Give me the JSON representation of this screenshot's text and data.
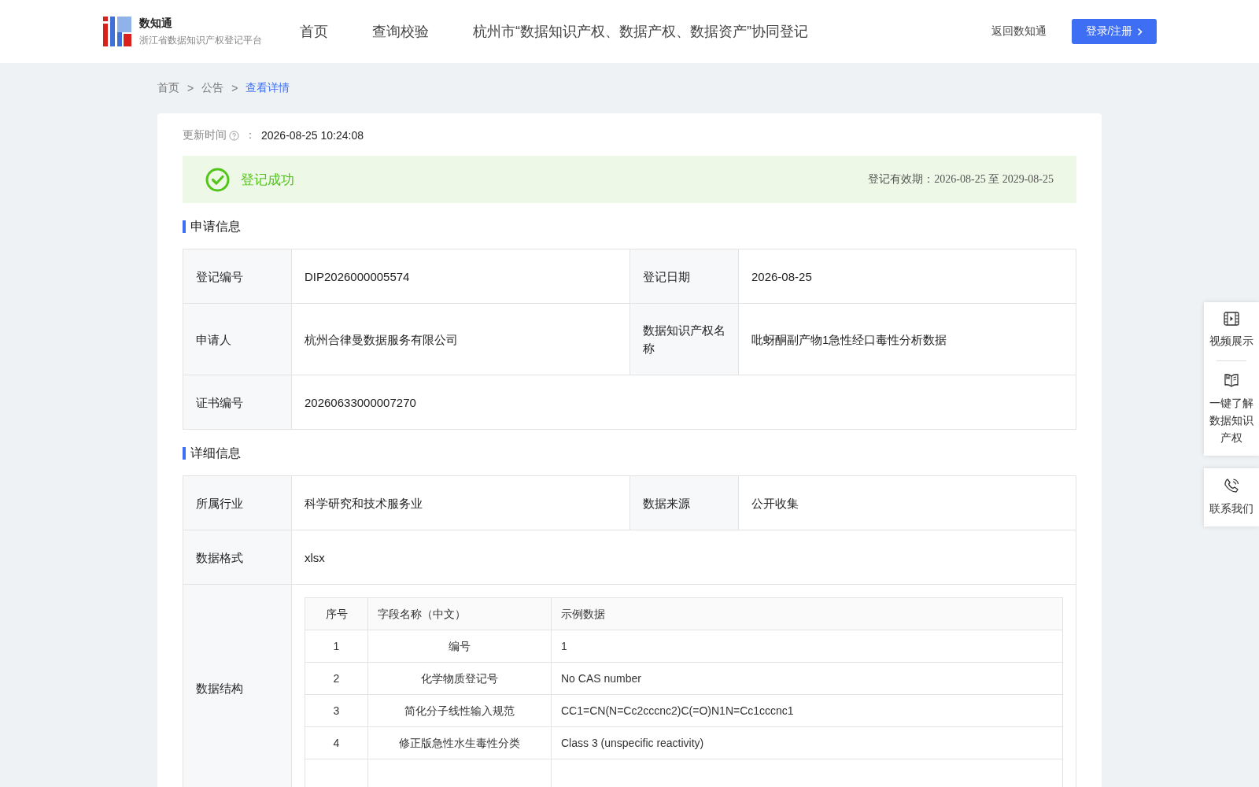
{
  "header": {
    "logo": {
      "title": "数知通",
      "subtitle": "浙江省数据知识产权登记平台"
    },
    "nav": [
      {
        "label": "首页",
        "selected": false
      },
      {
        "label": "查询校验",
        "selected": false
      },
      {
        "label": "杭州市“数据知识产权、数据产权、数据资产”协同登记",
        "selected": false
      }
    ],
    "back_link": "返回数知通",
    "login_button": "登录/注册"
  },
  "breadcrumb": [
    {
      "label": "首页",
      "selected": false
    },
    {
      "label": "公告",
      "selected": false
    },
    {
      "label": "查看详情",
      "selected": true
    }
  ],
  "breadcrumb_separator": ">",
  "update": {
    "label": "更新时间",
    "separator": "：",
    "value": "2026-08-25 10:24:08"
  },
  "status": {
    "kind": "success",
    "label": "登记成功",
    "validity": "登记有效期：2026-08-25 至 2029-08-25"
  },
  "sections": [
    {
      "title": "申请信息",
      "rows": [
        [
          {
            "label": "登记编号",
            "value": "DIP2026000005574"
          },
          {
            "label": "登记日期",
            "value": "2026-08-25"
          }
        ],
        [
          {
            "label": "申请人",
            "value": "杭州合律曼数据服务有限公司"
          },
          {
            "label": "数据知识产权名称",
            "value": "吡蚜酮副产物1急性经口毒性分析数据"
          }
        ],
        [
          {
            "label": "证书编号",
            "value": "20260633000007270"
          }
        ]
      ]
    },
    {
      "title": "详细信息",
      "rows": [
        [
          {
            "label": "所属行业",
            "value": "科学研究和技术服务业"
          },
          {
            "label": "数据来源",
            "value": "公开收集"
          }
        ],
        [
          {
            "label": "数据格式",
            "value": "xlsx"
          }
        ],
        [
          {
            "label": "数据结构",
            "table": {
              "columns": [
                "序号",
                "字段名称（中文）",
                "示例数据"
              ],
              "rows": [
                [
                  "1",
                  "编号",
                  "1"
                ],
                [
                  "2",
                  "化学物质登记号",
                  "No CAS number"
                ],
                [
                  "3",
                  "简化分子线性输入规范",
                  "CC1=CN(N=Cc2cccnc2)C(=O)N1N=Cc1cccnc1"
                ],
                [
                  "4",
                  "修正版急性水生毒性分类",
                  "Class 3 (unspecific reactivity)"
                ]
              ]
            }
          }
        ]
      ]
    }
  ],
  "side_panel": [
    [
      {
        "label": "视频展示"
      },
      {
        "label": "一键了解数据知识产权"
      }
    ],
    [
      {
        "label": "联系我们"
      }
    ]
  ]
}
